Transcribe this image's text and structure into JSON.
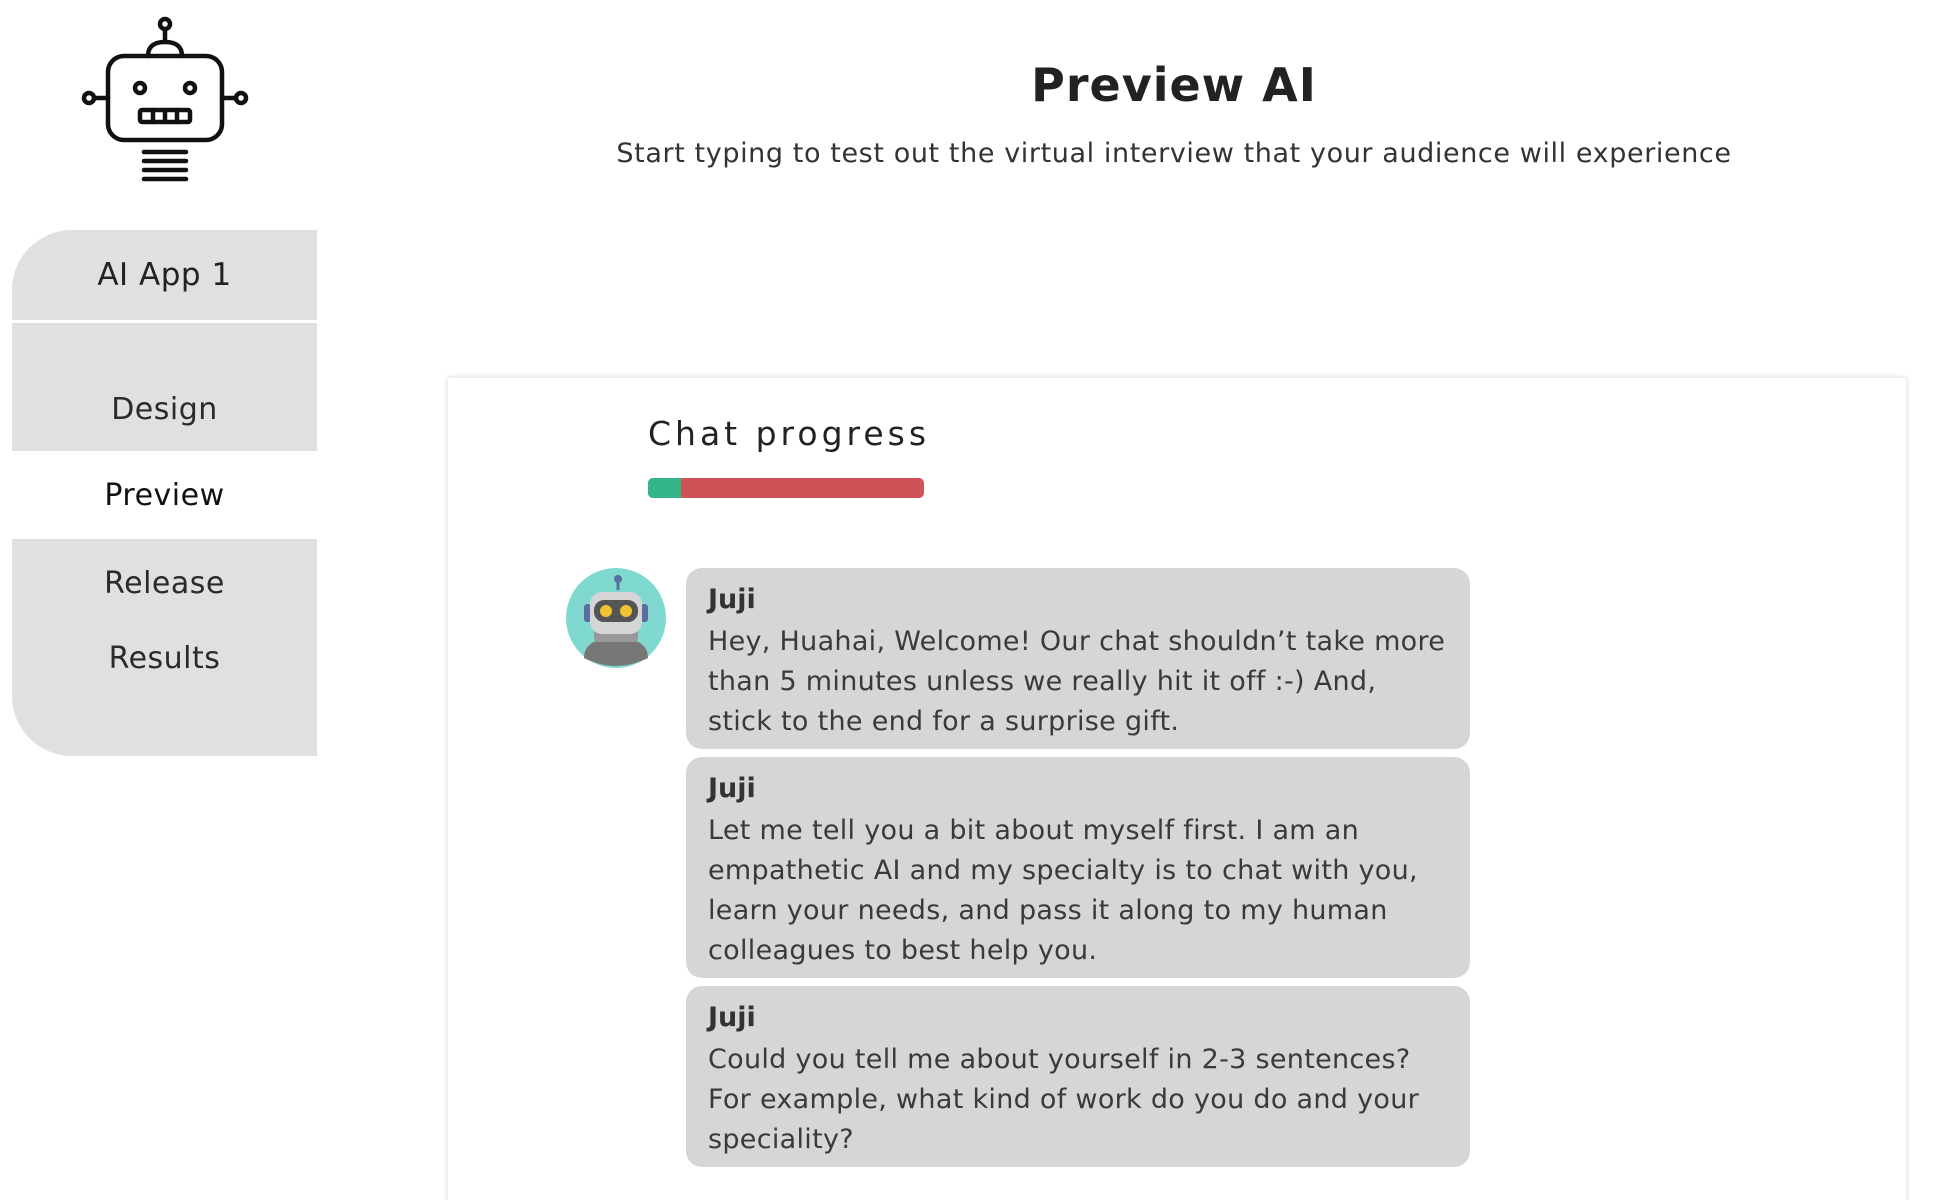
{
  "logo": {
    "icon": "robot-outline-icon"
  },
  "sidebar": {
    "app_name": "AI App 1",
    "items": [
      {
        "label": "Design",
        "active": false
      },
      {
        "label": "Preview",
        "active": true
      },
      {
        "label": "Release",
        "active": false
      },
      {
        "label": "Results",
        "active": false
      }
    ]
  },
  "header": {
    "title": "Preview AI",
    "subtitle": "Start typing to test out the virtual interview that your audience will experience"
  },
  "chat": {
    "progress_label": "Chat progress",
    "progress_fraction": 0.12,
    "progress_color": "#35b58a",
    "progress_remaining_color": "#cf5256",
    "avatar_icon": "juji-robot-avatar-icon",
    "messages": [
      {
        "sender": "Juji",
        "text": "Hey, Huahai, Welcome! Our chat shouldn’t take more than 5 minutes unless we really hit it off :-) And, stick to the end for a surprise gift."
      },
      {
        "sender": "Juji",
        "text": "Let me tell you a bit about myself first. I am an empathetic AI and my specialty is to chat with you, learn your needs, and pass it along to my human colleagues to best help you."
      },
      {
        "sender": "Juji",
        "text": "Could you tell me about yourself in 2-3 sentences? For example, what kind of work do you do and your speciality?"
      }
    ]
  }
}
